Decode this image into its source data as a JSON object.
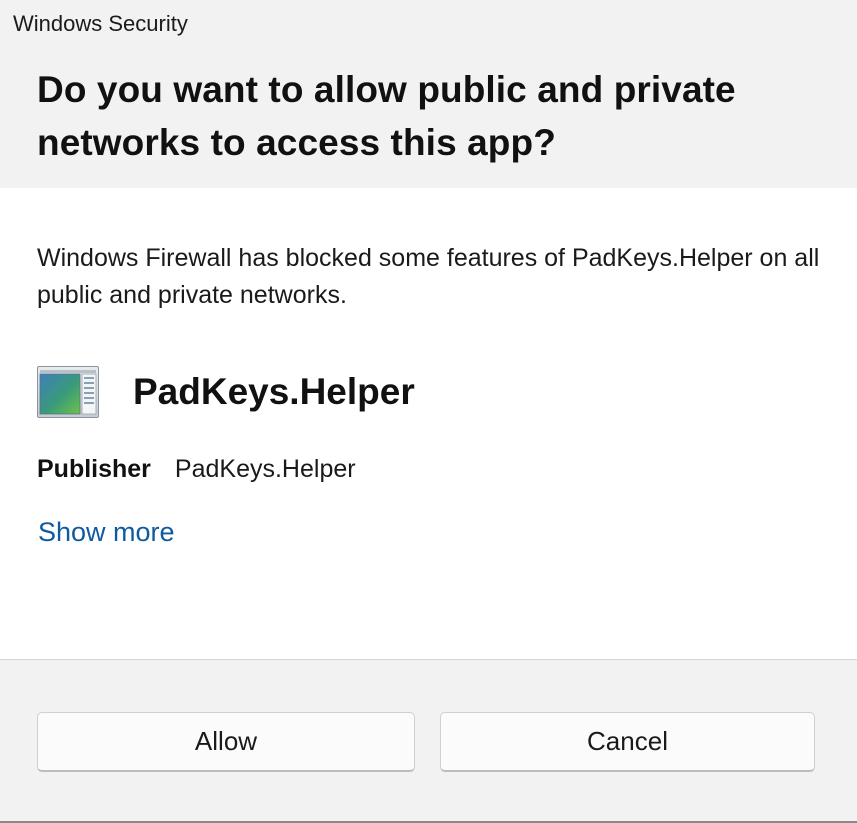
{
  "window": {
    "title": "Windows Security"
  },
  "header": {
    "question": "Do you want to allow public and private networks to access this app?"
  },
  "body": {
    "message": "Windows Firewall has blocked some features of PadKeys.Helper on all public and private networks.",
    "app": {
      "name": "PadKeys.Helper",
      "icon": "app-window-icon"
    },
    "publisher": {
      "label": "Publisher",
      "value": "PadKeys.Helper"
    },
    "show_more_label": "Show more"
  },
  "footer": {
    "allow_label": "Allow",
    "cancel_label": "Cancel"
  },
  "colors": {
    "header_bg": "#f2f2f2",
    "link": "#0f5a9e",
    "button_bg": "#fbfbfb"
  }
}
